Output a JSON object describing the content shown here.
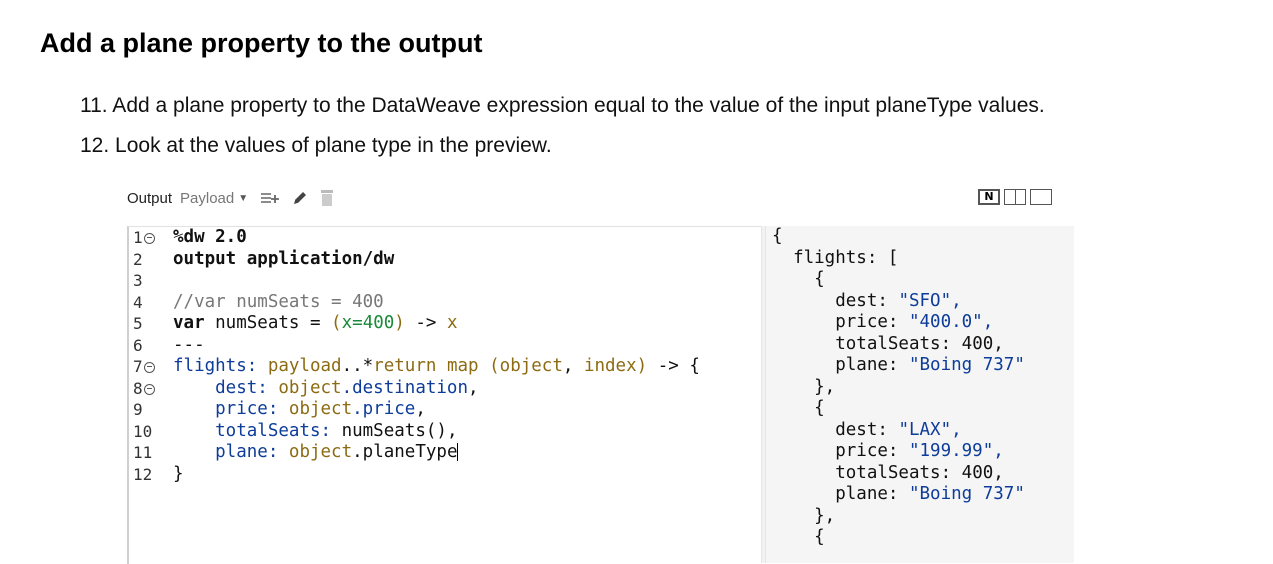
{
  "doc": {
    "title": "Add a plane property to the output",
    "steps": [
      "11. Add a plane property to the DataWeave expression equal to the value of the input planeType values.",
      "12. Look at the values of plane type in the preview."
    ]
  },
  "toolbar": {
    "output_label": "Output",
    "payload_label": "Payload",
    "icons": [
      "caret-down-icon",
      "add-mapping-icon",
      "pencil-icon",
      "trash-icon"
    ],
    "view_toggle_label": "N"
  },
  "editor": {
    "line_numbers": [
      "1",
      "2",
      "3",
      "4",
      "5",
      "6",
      "7",
      "8",
      "9",
      "10",
      "11",
      "12"
    ],
    "line1": {
      "text": "%dw 2.0"
    },
    "line2": {
      "kw": "output",
      "rest": " application/dw"
    },
    "line4": {
      "comment": "//var numSeats = 400"
    },
    "line5": {
      "kw": "var",
      "name": " numSeats = ",
      "paren_open": "(",
      "param": "x",
      "eq": "=",
      "num": "400",
      "paren_close": ")",
      "arrow": " -> ",
      "ret": "x"
    },
    "line6": {
      "text": "---"
    },
    "line7": {
      "key": "flights: ",
      "var": "payload",
      "sel": "..*",
      "field": "return",
      "op": " map ",
      "paren": "(",
      "p1": "object",
      "comma": ", ",
      "p2": "index",
      "paren_close": ")",
      "tail": " -> {"
    },
    "line8": {
      "key": "    dest: ",
      "obj": "object",
      "field": ".destination",
      "tail": ","
    },
    "line9": {
      "key": "    price: ",
      "obj": "object",
      "field": ".price",
      "tail": ","
    },
    "line10": {
      "key": "    totalSeats: ",
      "fn": "numSeats()",
      "tail": ","
    },
    "line11": {
      "key": "    plane: ",
      "obj": "object",
      "field": ".planeType"
    },
    "line12": {
      "text": "}"
    }
  },
  "preview": {
    "lines": [
      {
        "t": "{"
      },
      {
        "t": "  flights: ["
      },
      {
        "t": "    {"
      },
      {
        "k": "      dest: ",
        "v": "\"SFO\","
      },
      {
        "k": "      price: ",
        "v": "\"400.0\","
      },
      {
        "k": "      totalSeats: ",
        "v": "400,"
      },
      {
        "k": "      plane: ",
        "v": "\"Boing 737\""
      },
      {
        "t": "    },"
      },
      {
        "t": "    {"
      },
      {
        "k": "      dest: ",
        "v": "\"LAX\","
      },
      {
        "k": "      price: ",
        "v": "\"199.99\","
      },
      {
        "k": "      totalSeats: ",
        "v": "400,"
      },
      {
        "k": "      plane: ",
        "v": "\"Boing 737\""
      },
      {
        "t": "    },"
      },
      {
        "t": "    {"
      }
    ]
  },
  "colors": {
    "keyword": "#111111",
    "comment": "#777777",
    "number": "#1a8a3a",
    "variable": "#8c6b12",
    "identifier": "#0d3c9a",
    "preview_bg": "#f5f5f5"
  }
}
